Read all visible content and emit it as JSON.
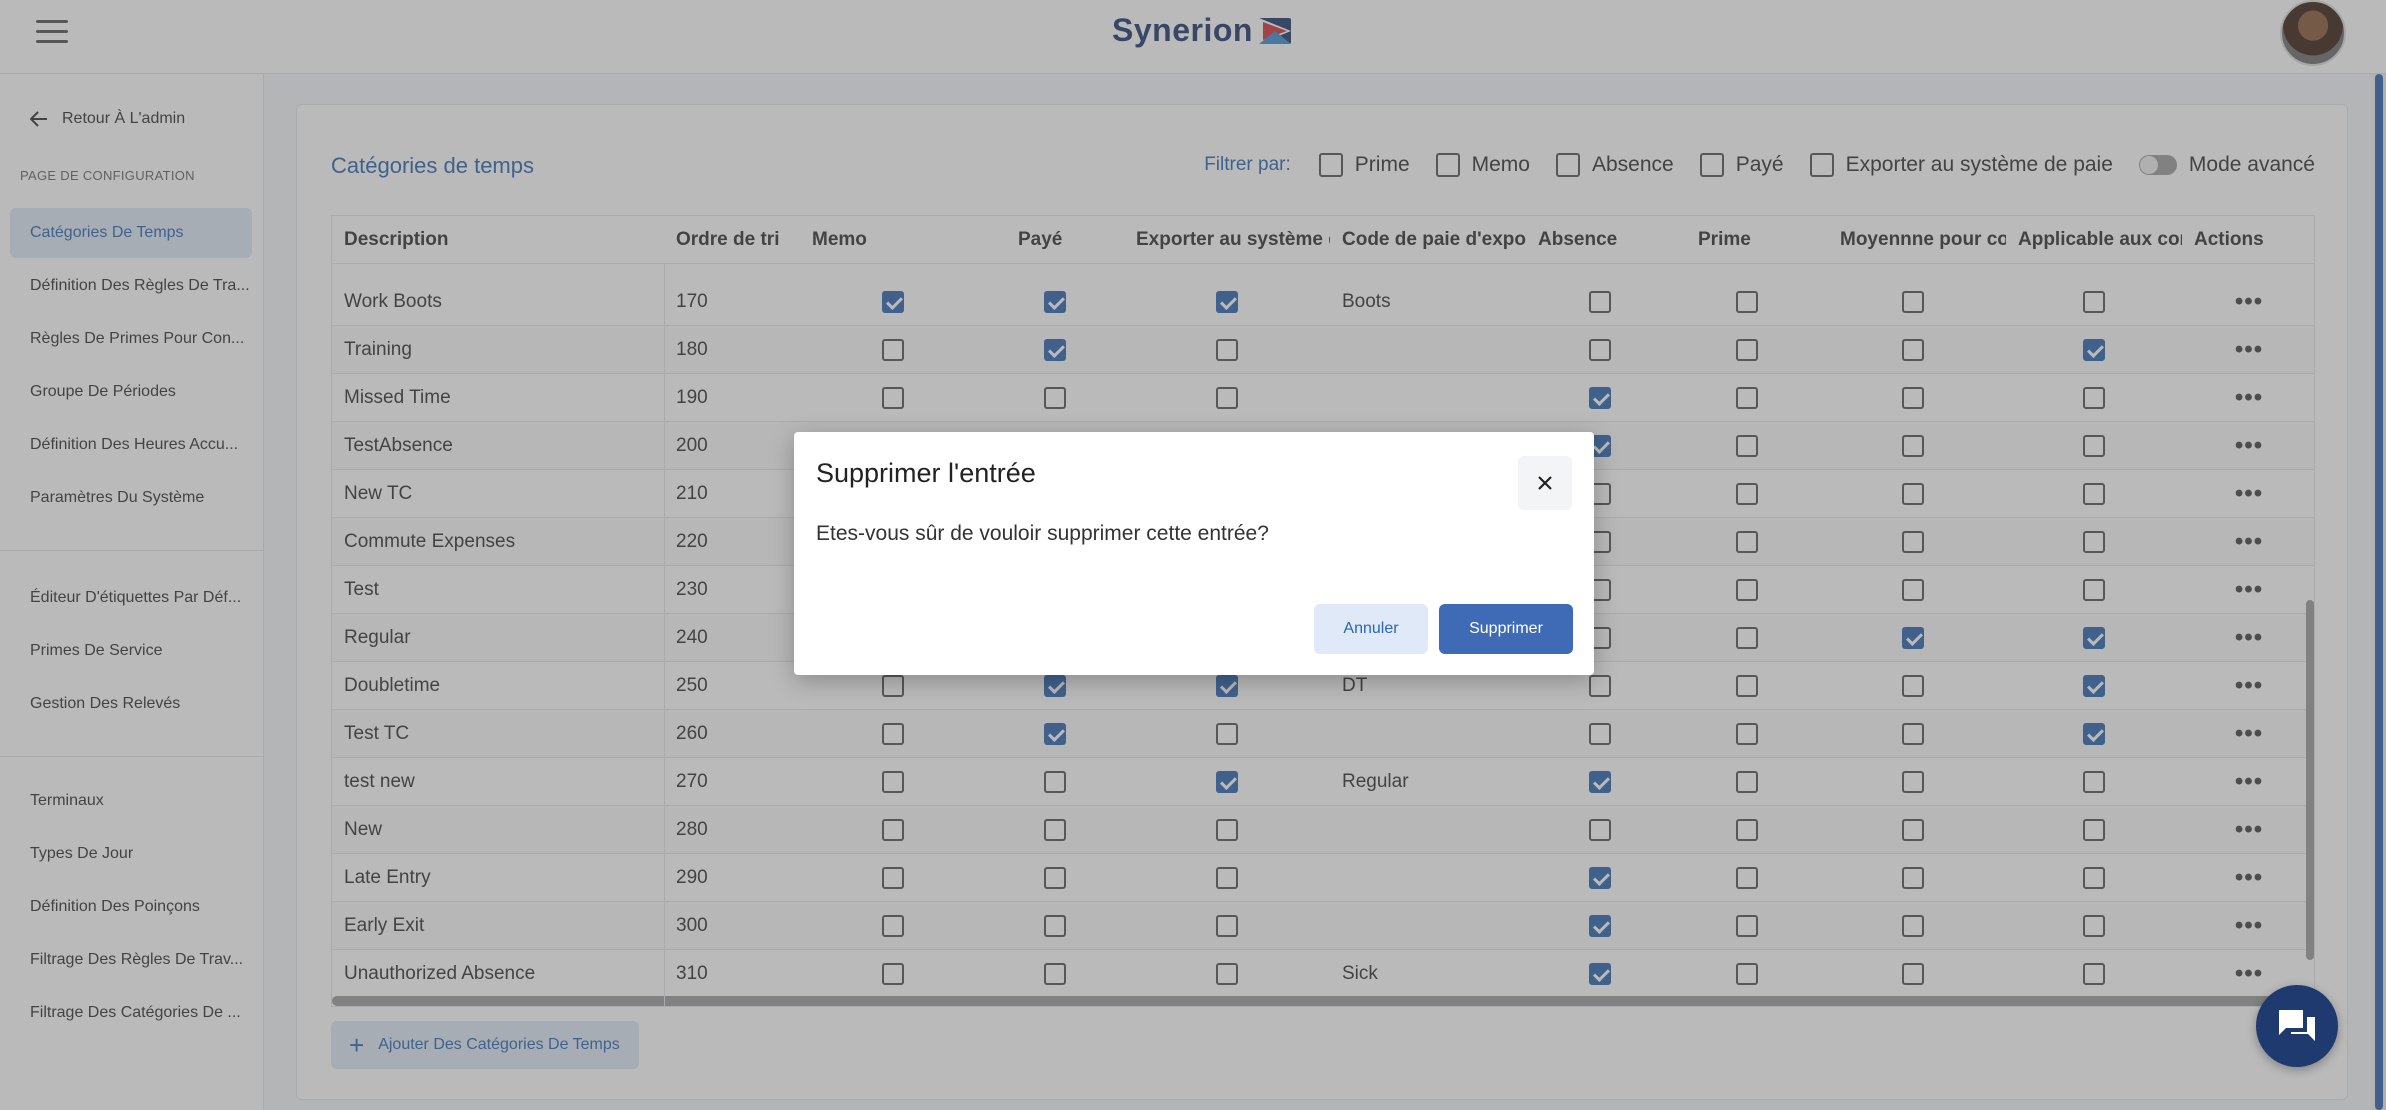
{
  "header": {
    "logo_text": "Synerion",
    "icons": [
      "hamburger-icon",
      "avatar"
    ]
  },
  "sidebar": {
    "back_label": "Retour À L'admin",
    "section_label": "PAGE DE CONFIGURATION",
    "group1": [
      {
        "label": "Catégories De Temps",
        "active": true
      },
      {
        "label": "Définition Des Règles De Tra..."
      },
      {
        "label": "Règles De Primes Pour Con..."
      },
      {
        "label": "Groupe De Périodes"
      },
      {
        "label": "Définition Des Heures Accu..."
      },
      {
        "label": "Paramètres Du Système"
      }
    ],
    "group2": [
      {
        "label": "Éditeur D'étiquettes Par Déf..."
      },
      {
        "label": "Primes De Service"
      },
      {
        "label": "Gestion Des Relevés"
      }
    ],
    "group3": [
      {
        "label": "Terminaux"
      },
      {
        "label": "Types De Jour"
      },
      {
        "label": "Définition Des Poinçons"
      },
      {
        "label": "Filtrage Des Règles De Trav..."
      },
      {
        "label": "Filtrage Des Catégories De ..."
      }
    ]
  },
  "card": {
    "title": "Catégories de temps",
    "filter_label": "Filtrer par:",
    "filters": [
      "Prime",
      "Memo",
      "Absence",
      "Payé",
      "Exporter au système de paie"
    ],
    "advanced_mode_label": "Mode avancé",
    "add_button_label": "Ajouter Des Catégories De Temps"
  },
  "table": {
    "headers": [
      "Description",
      "Ordre de tri",
      "Memo",
      "Payé",
      "Exporter au système d",
      "Code de paie d'expor",
      "Absence",
      "Prime",
      "Moyennne pour cor",
      "Applicable aux con",
      "Actions"
    ],
    "rows": [
      {
        "desc": "Work Boots",
        "order": "170",
        "memo": true,
        "paye": true,
        "export": true,
        "code": "Boots",
        "absence": false,
        "prime": false,
        "moy": false,
        "appl": false
      },
      {
        "desc": "Training",
        "order": "180",
        "memo": false,
        "paye": true,
        "export": false,
        "code": "",
        "absence": false,
        "prime": false,
        "moy": false,
        "appl": true
      },
      {
        "desc": "Missed Time",
        "order": "190",
        "memo": false,
        "paye": false,
        "export": false,
        "code": "",
        "absence": true,
        "prime": false,
        "moy": false,
        "appl": false
      },
      {
        "desc": "TestAbsence",
        "order": "200",
        "memo": false,
        "paye": false,
        "export": false,
        "code": "",
        "absence": true,
        "prime": false,
        "moy": false,
        "appl": false
      },
      {
        "desc": "New TC",
        "order": "210",
        "memo": false,
        "paye": false,
        "export": false,
        "code": "",
        "absence": false,
        "prime": false,
        "moy": false,
        "appl": false
      },
      {
        "desc": "Commute Expenses",
        "order": "220",
        "memo": false,
        "paye": false,
        "export": false,
        "code": "",
        "absence": false,
        "prime": false,
        "moy": false,
        "appl": false
      },
      {
        "desc": "Test",
        "order": "230",
        "memo": false,
        "paye": false,
        "export": false,
        "code": "",
        "absence": false,
        "prime": false,
        "moy": false,
        "appl": false
      },
      {
        "desc": "Regular",
        "order": "240",
        "memo": false,
        "paye": false,
        "export": false,
        "code": "",
        "absence": false,
        "prime": false,
        "moy": true,
        "appl": true
      },
      {
        "desc": "Doubletime",
        "order": "250",
        "memo": false,
        "paye": true,
        "export": true,
        "code": "DT",
        "absence": false,
        "prime": false,
        "moy": false,
        "appl": true
      },
      {
        "desc": "Test TC",
        "order": "260",
        "memo": false,
        "paye": true,
        "export": false,
        "code": "",
        "absence": false,
        "prime": false,
        "moy": false,
        "appl": true
      },
      {
        "desc": "test new",
        "order": "270",
        "memo": false,
        "paye": false,
        "export": true,
        "code": "Regular",
        "absence": true,
        "prime": false,
        "moy": false,
        "appl": false
      },
      {
        "desc": "New",
        "order": "280",
        "memo": false,
        "paye": false,
        "export": false,
        "code": "",
        "absence": false,
        "prime": false,
        "moy": false,
        "appl": false
      },
      {
        "desc": "Late Entry",
        "order": "290",
        "memo": false,
        "paye": false,
        "export": false,
        "code": "",
        "absence": true,
        "prime": false,
        "moy": false,
        "appl": false
      },
      {
        "desc": "Early Exit",
        "order": "300",
        "memo": false,
        "paye": false,
        "export": false,
        "code": "",
        "absence": true,
        "prime": false,
        "moy": false,
        "appl": false
      },
      {
        "desc": "Unauthorized Absence",
        "order": "310",
        "memo": false,
        "paye": false,
        "export": false,
        "code": "Sick",
        "absence": true,
        "prime": false,
        "moy": false,
        "appl": false
      }
    ]
  },
  "modal": {
    "title": "Supprimer l'entrée",
    "body": "Etes-vous sûr de vouloir supprimer cette entrée?",
    "cancel_label": "Annuler",
    "delete_label": "Supprimer"
  },
  "colors": {
    "brand": "#1f3a6e",
    "accent": "#2f66b2",
    "active_bg": "#dfe9f7",
    "delete_button": "#3f6bb6"
  }
}
